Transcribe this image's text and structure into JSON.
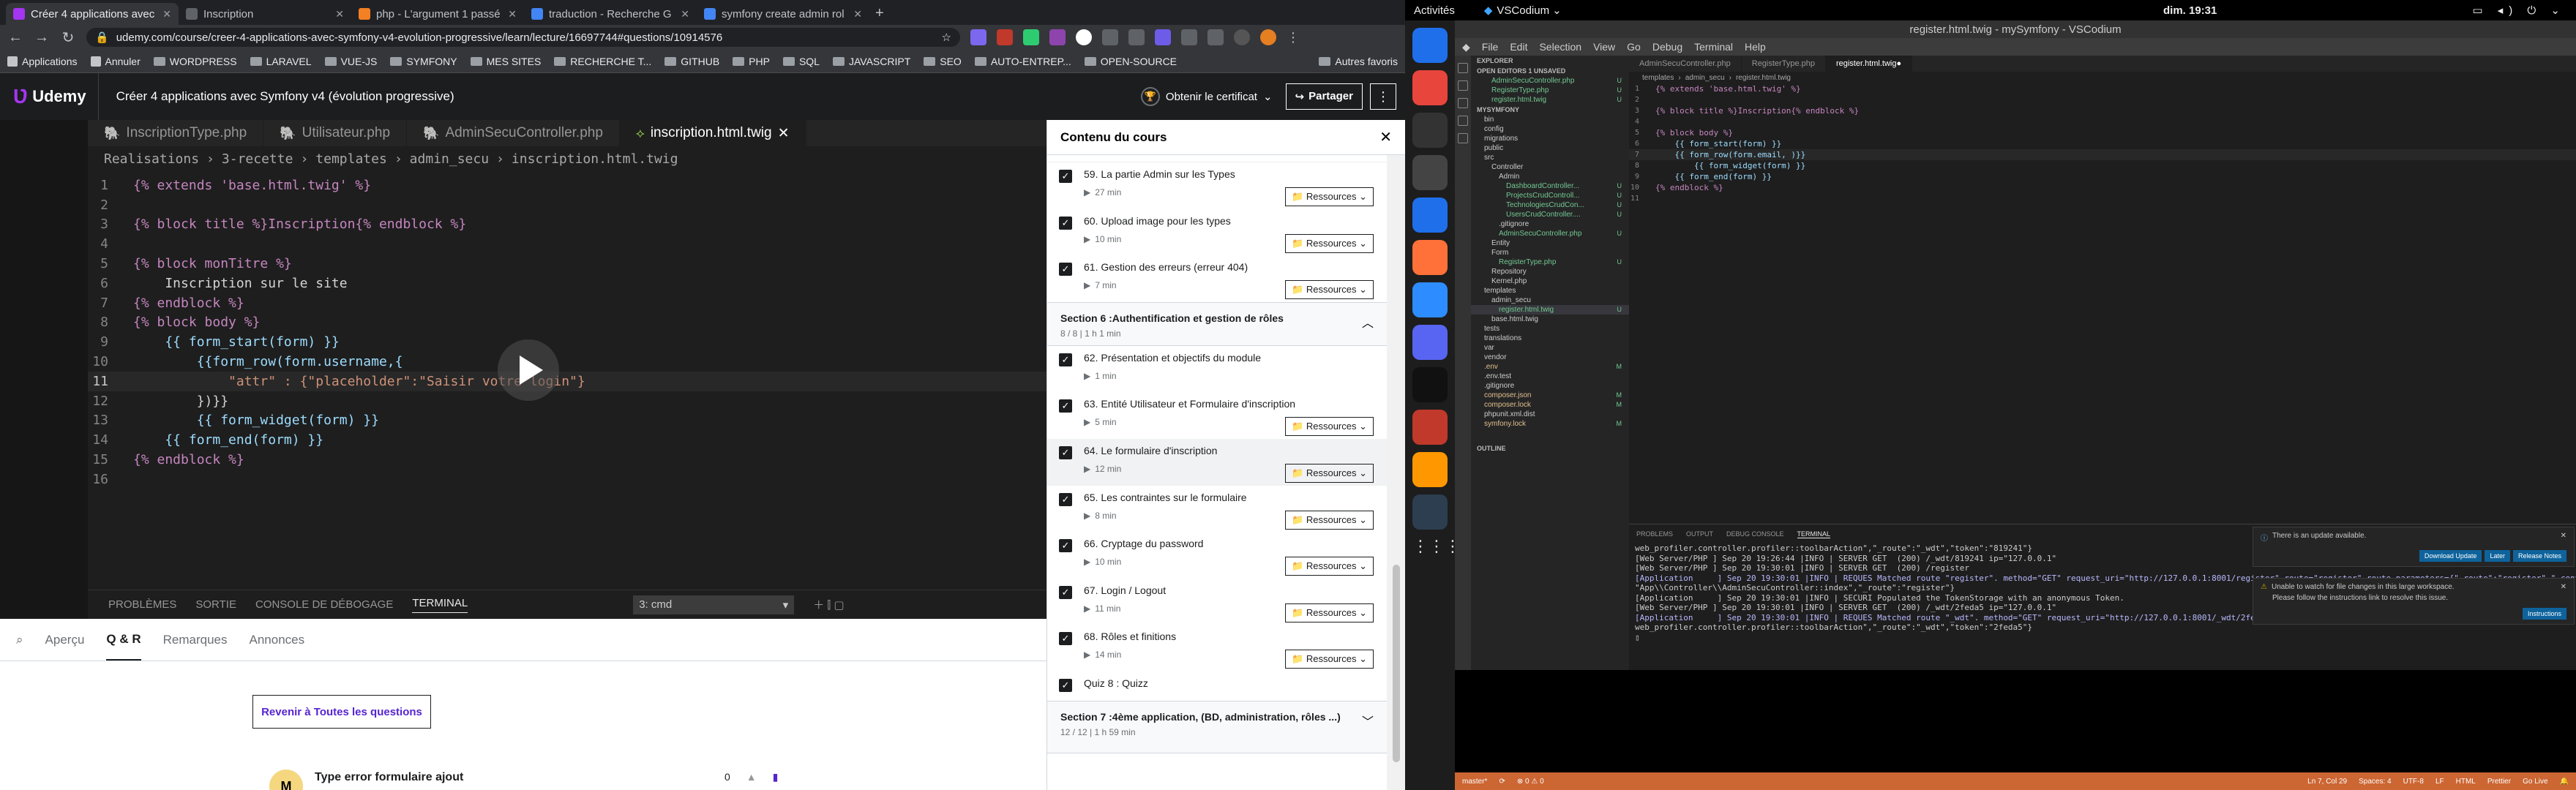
{
  "browser": {
    "tabs": [
      {
        "title": "Créer 4 applications avec",
        "color": "#a435f0",
        "active": true
      },
      {
        "title": "Inscription",
        "color": "#5f6368",
        "active": false
      },
      {
        "title": "php - L'argument 1 passé",
        "color": "#f48024",
        "active": false
      },
      {
        "title": "traduction - Recherche G",
        "color": "#4285f4",
        "active": false
      },
      {
        "title": "symfony create admin rol",
        "color": "#4285f4",
        "active": false
      }
    ],
    "new_tab": "+",
    "url": "udemy.com/course/creer-4-applications-avec-symfony-v4-evolution-progressive/learn/lecture/16697744#questions/10914576",
    "bookmarks": [
      "Applications",
      "Annuler",
      "WORDPRESS",
      "LARAVEL",
      "VUE-JS",
      "SYMFONY",
      "MES SITES",
      "RECHERCHE T...",
      "GITHUB",
      "PHP",
      "SQL",
      "JAVASCRIPT",
      "SEO",
      "AUTO-ENTREP...",
      "OPEN-SOURCE"
    ],
    "other_bookmarks": "Autres favoris"
  },
  "udemy": {
    "logo": "Udemy",
    "course_title": "Créer 4 applications avec Symfony v4 (évolution progressive)",
    "certificate": "Obtenir le certificat",
    "share": "Partager"
  },
  "video_editor": {
    "tabs": [
      "InscriptionType.php",
      "Utilisateur.php",
      "AdminSecuController.php",
      "inscription.html.twig"
    ],
    "breadcrumb": [
      "Realisations",
      "3-recette",
      "templates",
      "admin_secu",
      "inscription.html.twig"
    ],
    "code_lines": [
      "{% extends 'base.html.twig' %}",
      "",
      "{% block title %}Inscription{% endblock %}",
      "",
      "{% block monTitre %}",
      "    Inscription sur le site",
      "{% endblock %}",
      "{% block body %}",
      "    {{ form_start(form) }}",
      "        {{form_row(form.username,{",
      "            \"attr\" : {\"placeholder\":\"Saisir votre login\"}",
      "        })}}",
      "        {{ form_widget(form) }}",
      "    {{ form_end(form) }}",
      "{% endblock %}",
      ""
    ],
    "current_line": 11,
    "panel_tabs": [
      "PROBLÈMES",
      "SORTIE",
      "CONSOLE DE DÉBOGAGE",
      "TERMINAL"
    ],
    "terminal_select": "3: cmd"
  },
  "questions": {
    "tabs": [
      "Aperçu",
      "Q & R",
      "Remarques",
      "Annonces"
    ],
    "back_button": "Revenir à Toutes les questions",
    "item_avatar": "M",
    "item_title": "Type error formulaire ajout",
    "item_count": "0"
  },
  "sidebar": {
    "title": "Contenu du cours",
    "resources_label": "Ressources",
    "items": [
      {
        "kind": "lecture",
        "title": "59. La partie Admin sur les Types",
        "duration": "27 min",
        "res": true
      },
      {
        "kind": "lecture",
        "title": "60. Upload image pour les types",
        "duration": "10 min",
        "res": true
      },
      {
        "kind": "lecture",
        "title": "61. Gestion des erreurs (erreur 404)",
        "duration": "7 min",
        "res": true
      },
      {
        "kind": "section",
        "title": "Section 6 :Authentification et gestion de rôles",
        "sub": "8 / 8 | 1 h 1 min"
      },
      {
        "kind": "lecture",
        "title": "62. Présentation et objectifs du module",
        "duration": "1 min",
        "res": false
      },
      {
        "kind": "lecture",
        "title": "63. Entité Utilisateur et Formulaire d'inscription",
        "duration": "5 min",
        "res": true
      },
      {
        "kind": "lecture",
        "title": "64. Le formulaire d'inscription",
        "duration": "12 min",
        "res": true,
        "current": true
      },
      {
        "kind": "lecture",
        "title": "65. Les contraintes sur le formulaire",
        "duration": "8 min",
        "res": true
      },
      {
        "kind": "lecture",
        "title": "66. Cryptage du password",
        "duration": "10 min",
        "res": true
      },
      {
        "kind": "lecture",
        "title": "67. Login / Logout",
        "duration": "11 min",
        "res": true
      },
      {
        "kind": "lecture",
        "title": "68. Rôles et finitions",
        "duration": "14 min",
        "res": true
      },
      {
        "kind": "quiz",
        "title": "Quiz 8 : Quizz"
      },
      {
        "kind": "section",
        "title": "Section 7 :4ème application, (BD, administration, rôles ...)",
        "sub": "12 / 12 | 1 h 59 min"
      }
    ]
  },
  "desktop": {
    "activities": "Activités",
    "app_name": "VSCodium",
    "clock": "dim. 19:31"
  },
  "vscodium": {
    "title": "register.html.twig - mySymfony - VSCodium",
    "menu": [
      "File",
      "Edit",
      "Selection",
      "View",
      "Go",
      "Debug",
      "Terminal",
      "Help"
    ],
    "explorer": [
      {
        "t": "EXPLORER",
        "h": true
      },
      {
        "t": "OPEN EDITORS 1 UNSAVED",
        "h": true
      },
      {
        "t": "AdminSecuController.php",
        "i": 2,
        "m": "U"
      },
      {
        "t": "RegisterType.php",
        "i": 2,
        "m": "U"
      },
      {
        "t": "register.html.twig",
        "i": 2,
        "m": "U"
      },
      {
        "t": "MYSYMFONY",
        "h": true
      },
      {
        "t": "bin",
        "i": 1
      },
      {
        "t": "config",
        "i": 1
      },
      {
        "t": "migrations",
        "i": 1
      },
      {
        "t": "public",
        "i": 1
      },
      {
        "t": "src",
        "i": 1
      },
      {
        "t": "Controller",
        "i": 2
      },
      {
        "t": "Admin",
        "i": 3
      },
      {
        "t": "DashboardController...",
        "i": 4,
        "m": "U"
      },
      {
        "t": "ProjectsCrudControll...",
        "i": 4,
        "m": "U"
      },
      {
        "t": "TechnologiesCrudCon...",
        "i": 4,
        "m": "U"
      },
      {
        "t": "UsersCrudController....",
        "i": 4,
        "m": "U"
      },
      {
        "t": ".gitignore",
        "i": 3
      },
      {
        "t": "AdminSecuController.php",
        "i": 3,
        "m": "U"
      },
      {
        "t": "Entity",
        "i": 2
      },
      {
        "t": "Form",
        "i": 2
      },
      {
        "t": "RegisterType.php",
        "i": 3,
        "m": "U"
      },
      {
        "t": "Repository",
        "i": 2
      },
      {
        "t": "Kernel.php",
        "i": 2
      },
      {
        "t": "templates",
        "i": 1
      },
      {
        "t": "admin_secu",
        "i": 2
      },
      {
        "t": "register.html.twig",
        "i": 3,
        "m": "U"
      },
      {
        "t": "base.html.twig",
        "i": 2
      },
      {
        "t": "tests",
        "i": 1
      },
      {
        "t": "translations",
        "i": 1
      },
      {
        "t": "var",
        "i": 1
      },
      {
        "t": "vendor",
        "i": 1
      },
      {
        "t": ".env",
        "i": 1,
        "m": "M"
      },
      {
        "t": ".env.test",
        "i": 1
      },
      {
        "t": ".gitignore",
        "i": 1
      },
      {
        "t": "composer.json",
        "i": 1,
        "m": "M"
      },
      {
        "t": "composer.lock",
        "i": 1,
        "m": "M"
      },
      {
        "t": "phpunit.xml.dist",
        "i": 1
      },
      {
        "t": "symfony.lock",
        "i": 1,
        "m": "M"
      }
    ],
    "outline": "OUTLINE",
    "tabs": [
      "AdminSecuController.php",
      "RegisterType.php",
      "register.html.twig"
    ],
    "breadcrumb": [
      "templates",
      "admin_secu",
      "register.html.twig"
    ],
    "code": [
      "{% extends 'base.html.twig' %}",
      "",
      "{% block title %}Inscription{% endblock %}",
      "",
      "{% block body %}",
      "    {{ form_start(form) }}",
      "    {{ form_row(form.email, )}}",
      "        {{ form_widget(form) }}",
      "    {{ form_end(form) }}",
      "{% endblock %}",
      ""
    ],
    "panel_tabs": [
      "PROBLEMS",
      "OUTPUT",
      "DEBUG CONSOLE",
      "TERMINAL"
    ],
    "terminal_select": "1: symfony",
    "terminal": [
      "web_profiler.controller.profiler::toolbarAction\",\"_route\":\"_wdt\",\"token\":\"819241\"}",
      "[Web Server/PHP ] Sep 20 19:26:44 |INFO | SERVER GET  (200) /_wdt/819241 ip=\"127.0.0.1\"",
      "[Web Server/PHP ] Sep 20 19:30:01 |INFO | SERVER GET  (200) /register",
      "[Application     ] Sep 20 19:30:01 |INFO | REQUES Matched route \"register\". method=\"GET\" request_uri=\"http://127.0.0.1:8001/register\" route=\"register\" route_parameters={\"_route\":\"register\",\"_controller\":",
      "\"App\\\\Controller\\\\AdminSecuController::index\",\"_route\":\"register\"}",
      "[Application     ] Sep 20 19:30:01 |INFO | SECURI Populated the TokenStorage with an anonymous Token.",
      "[Web Server/PHP ] Sep 20 19:30:01 |INFO | SERVER GET  (200) /_wdt/2feda5 ip=\"127.0.0.1\"",
      "[Application     ] Sep 20 19:30:01 |INFO | REQUES Matched route \"_wdt\". method=\"GET\" request_uri=\"http://127.0.0.1:8001/_wdt/2feda5\" route=\"_wdt\" route_parameters={\"_controller\":",
      "web_profiler.controller.profiler::toolbarAction\",\"_route\":\"_wdt\",\"token\":\"2feda5\"}"
    ],
    "notif_update": "There is an update available.",
    "notif_update_buttons": [
      "Download Update",
      "Later",
      "Release Notes"
    ],
    "notif_watch_1": "Unable to watch for file changes in this large workspace.",
    "notif_watch_2": "Please follow the instructions link to resolve this issue.",
    "notif_watch_button": "Instructions",
    "status_left": "master*",
    "status_right": [
      "Ln 7, Col 29",
      "Spaces: 4",
      "UTF-8",
      "LF",
      "HTML",
      "Prettier",
      "Go Live"
    ]
  },
  "colors": {
    "udemy_purple": "#a435f0",
    "vscode_status": "#cc6633",
    "chrome_bg": "#35363a"
  }
}
